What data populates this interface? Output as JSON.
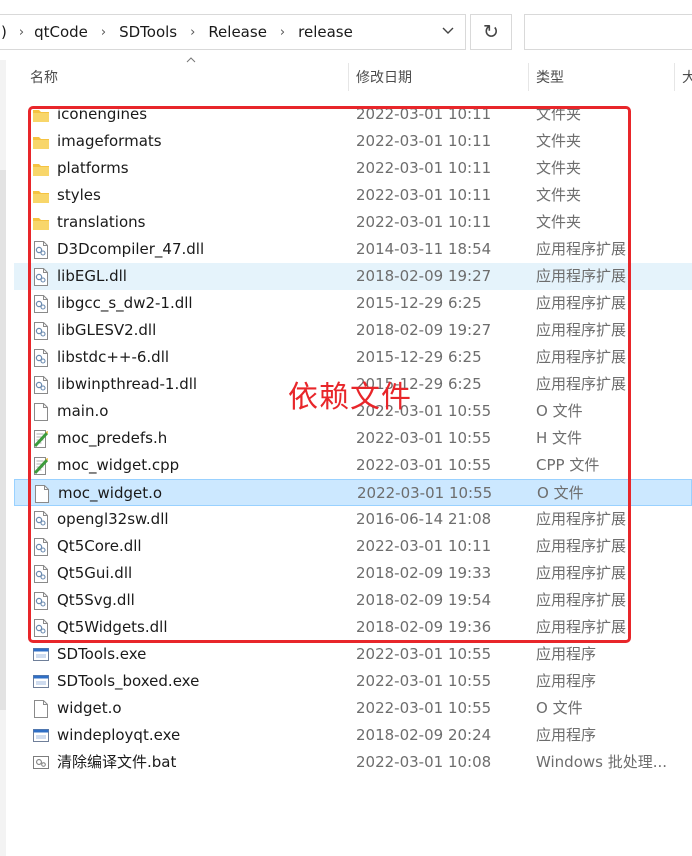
{
  "breadcrumb": {
    "lead": ")",
    "items": [
      "qtCode",
      "SDTools",
      "Release",
      "release"
    ],
    "separator": "›",
    "dropdown_glyph": "⌄"
  },
  "toolbar": {
    "refresh_glyph": "↻"
  },
  "columns": {
    "name": "名称",
    "date": "修改日期",
    "type": "类型",
    "size": "大"
  },
  "files": [
    {
      "name": "iconengines",
      "date": "2022-03-01 10:11",
      "type": "文件夹",
      "icon": "folder"
    },
    {
      "name": "imageformats",
      "date": "2022-03-01 10:11",
      "type": "文件夹",
      "icon": "folder"
    },
    {
      "name": "platforms",
      "date": "2022-03-01 10:11",
      "type": "文件夹",
      "icon": "folder"
    },
    {
      "name": "styles",
      "date": "2022-03-01 10:11",
      "type": "文件夹",
      "icon": "folder"
    },
    {
      "name": "translations",
      "date": "2022-03-01 10:11",
      "type": "文件夹",
      "icon": "folder"
    },
    {
      "name": "D3Dcompiler_47.dll",
      "date": "2014-03-11 18:54",
      "type": "应用程序扩展",
      "icon": "dll"
    },
    {
      "name": "libEGL.dll",
      "date": "2018-02-09 19:27",
      "type": "应用程序扩展",
      "icon": "dll",
      "state": "hover"
    },
    {
      "name": "libgcc_s_dw2-1.dll",
      "date": "2015-12-29 6:25",
      "type": "应用程序扩展",
      "icon": "dll"
    },
    {
      "name": "libGLESV2.dll",
      "date": "2018-02-09 19:27",
      "type": "应用程序扩展",
      "icon": "dll"
    },
    {
      "name": "libstdc++-6.dll",
      "date": "2015-12-29 6:25",
      "type": "应用程序扩展",
      "icon": "dll"
    },
    {
      "name": "libwinpthread-1.dll",
      "date": "2015-12-29 6:25",
      "type": "应用程序扩展",
      "icon": "dll"
    },
    {
      "name": "main.o",
      "date": "2022-03-01 10:55",
      "type": "O 文件",
      "icon": "blank"
    },
    {
      "name": "moc_predefs.h",
      "date": "2022-03-01 10:55",
      "type": "H 文件",
      "icon": "source"
    },
    {
      "name": "moc_widget.cpp",
      "date": "2022-03-01 10:55",
      "type": "CPP 文件",
      "icon": "source"
    },
    {
      "name": "moc_widget.o",
      "date": "2022-03-01 10:55",
      "type": "O 文件",
      "icon": "blank",
      "state": "selected"
    },
    {
      "name": "opengl32sw.dll",
      "date": "2016-06-14 21:08",
      "type": "应用程序扩展",
      "icon": "dll"
    },
    {
      "name": "Qt5Core.dll",
      "date": "2022-03-01 10:11",
      "type": "应用程序扩展",
      "icon": "dll"
    },
    {
      "name": "Qt5Gui.dll",
      "date": "2018-02-09 19:33",
      "type": "应用程序扩展",
      "icon": "dll"
    },
    {
      "name": "Qt5Svg.dll",
      "date": "2018-02-09 19:54",
      "type": "应用程序扩展",
      "icon": "dll"
    },
    {
      "name": "Qt5Widgets.dll",
      "date": "2018-02-09 19:36",
      "type": "应用程序扩展",
      "icon": "dll"
    },
    {
      "name": "SDTools.exe",
      "date": "2022-03-01 10:55",
      "type": "应用程序",
      "icon": "exe"
    },
    {
      "name": "SDTools_boxed.exe",
      "date": "2022-03-01 10:55",
      "type": "应用程序",
      "icon": "exe"
    },
    {
      "name": "widget.o",
      "date": "2022-03-01 10:55",
      "type": "O 文件",
      "icon": "blank"
    },
    {
      "name": "windeployqt.exe",
      "date": "2018-02-09 20:24",
      "type": "应用程序",
      "icon": "exe"
    },
    {
      "name": "清除编译文件.bat",
      "date": "2022-03-01 10:08",
      "type": "Windows 批处理...",
      "icon": "bat"
    }
  ],
  "annotation": {
    "label": "依赖文件",
    "color": "#e8262a"
  },
  "colors": {
    "hover": "#e5f3fb",
    "selected": "#cce8ff",
    "folder": "#f5c342"
  }
}
